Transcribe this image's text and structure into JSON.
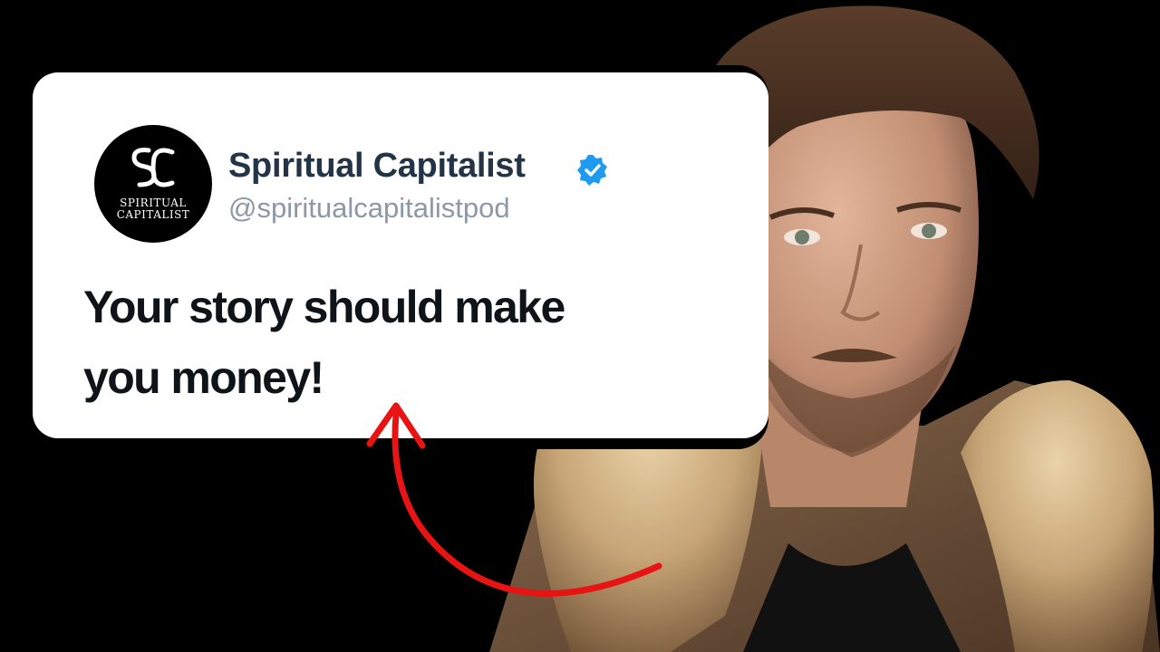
{
  "tweet": {
    "display_name": "Spiritual Capitalist",
    "handle": "@spiritualcapitalistpod",
    "text_line1": "Your story should make",
    "text_line2": "you money!",
    "verified_icon": "verified-badge-icon",
    "avatar": {
      "line1": "SPIRITUAL",
      "line2": "CAPITALIST"
    }
  },
  "colors": {
    "background": "#000000",
    "card": "#ffffff",
    "name": "#243447",
    "handle": "#8b98a5",
    "verified": "#1d9bf0",
    "arrow": "#e81414"
  }
}
